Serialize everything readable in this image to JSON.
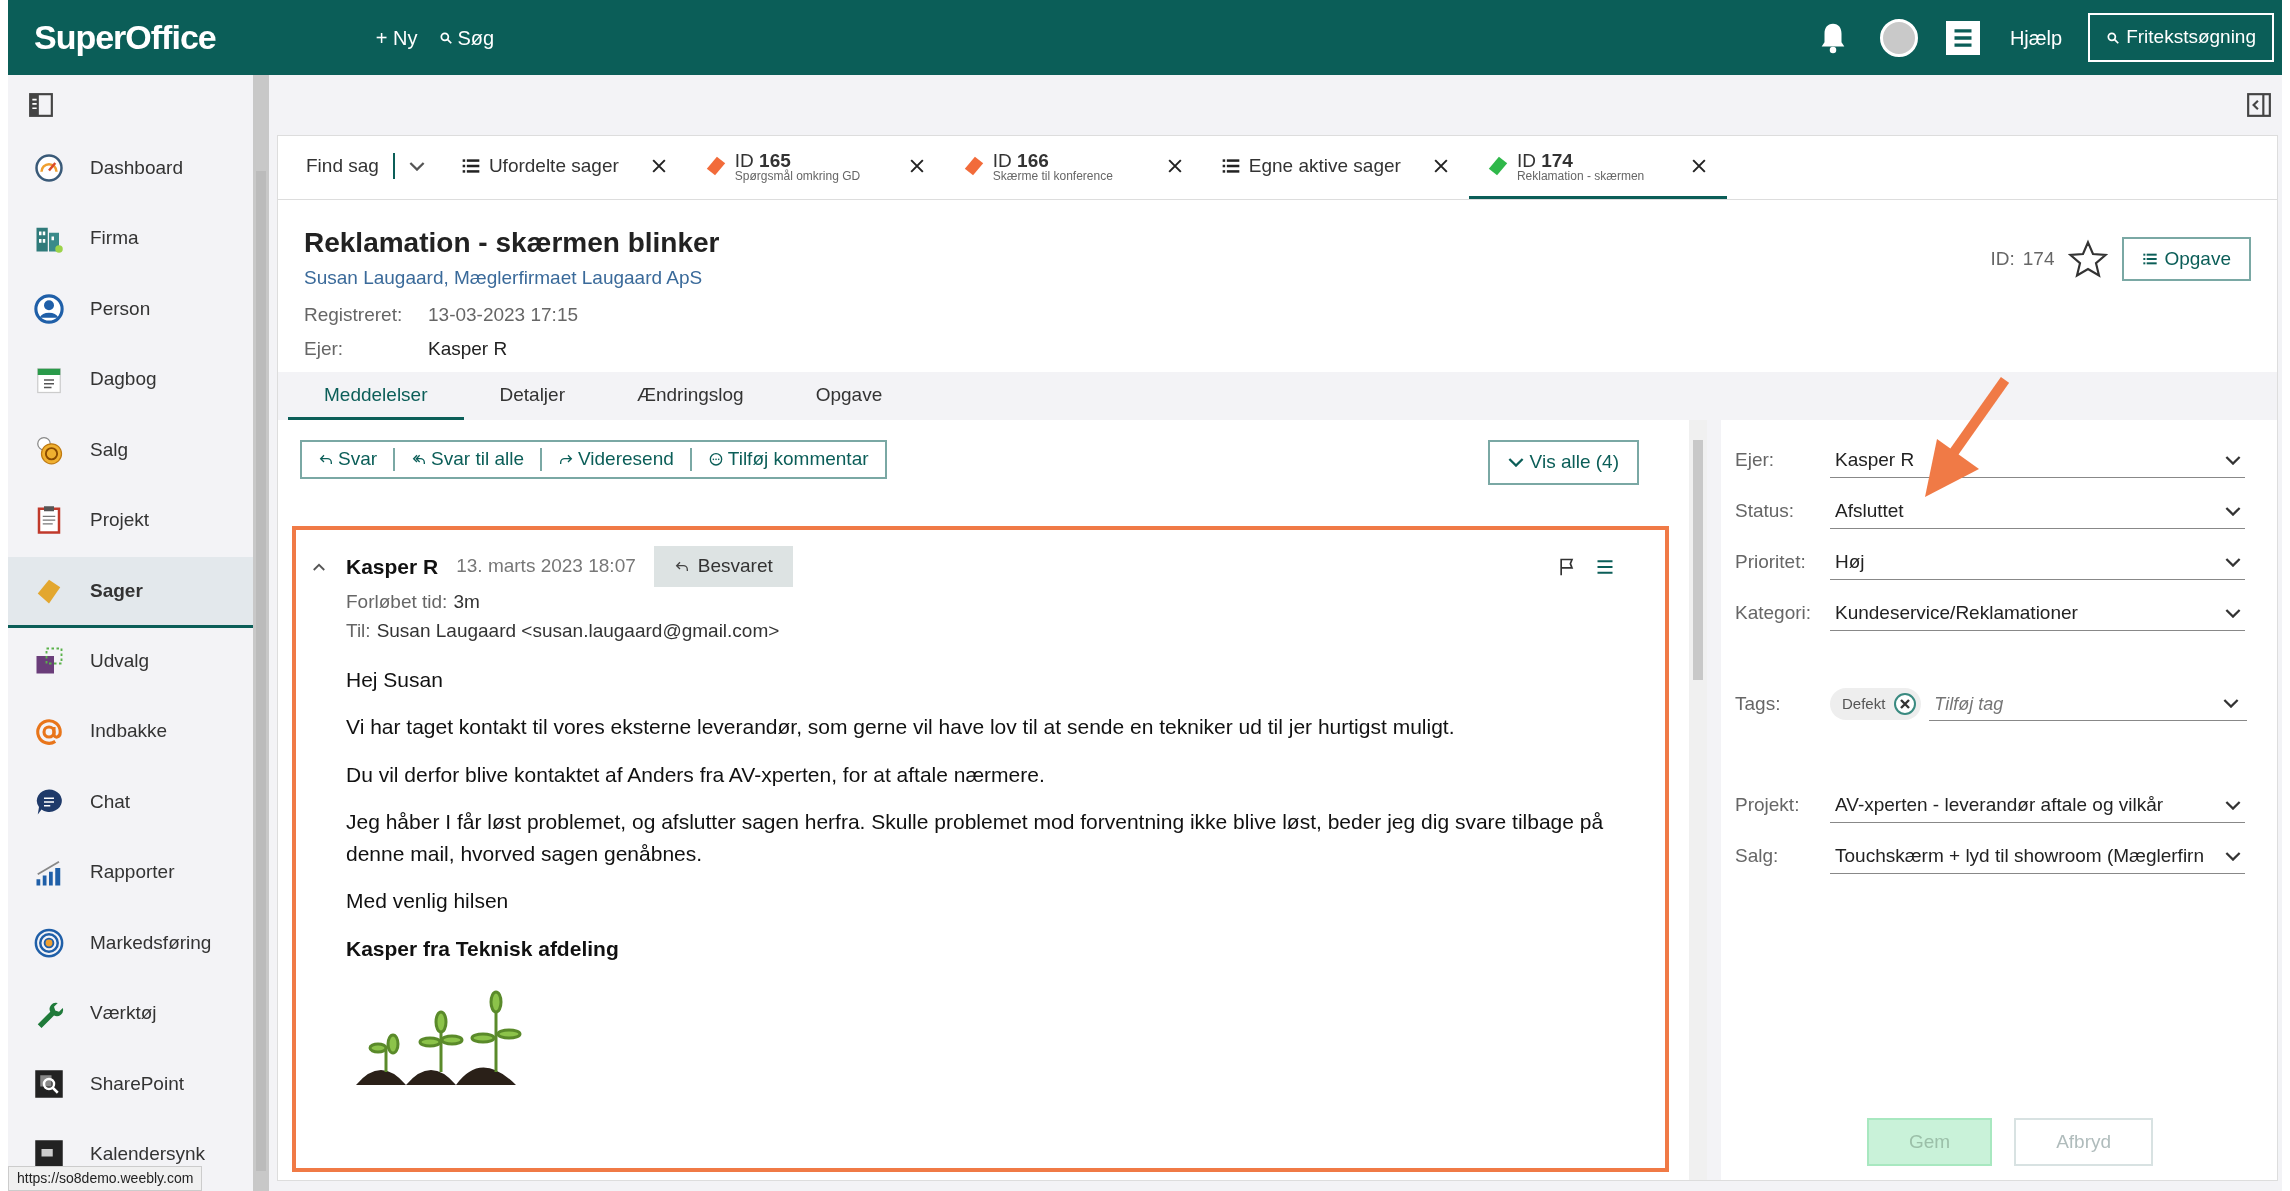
{
  "topbar": {
    "logo": "SuperOffice",
    "new": "+ Ny",
    "search": "Søg",
    "help": "Hjælp",
    "free_search": "Fritekstsøgning"
  },
  "sidebar": {
    "items": [
      {
        "label": "Dashboard",
        "selected": false
      },
      {
        "label": "Firma",
        "selected": false
      },
      {
        "label": "Person",
        "selected": false
      },
      {
        "label": "Dagbog",
        "selected": false
      },
      {
        "label": "Salg",
        "selected": false
      },
      {
        "label": "Projekt",
        "selected": false
      },
      {
        "label": "Sager",
        "selected": true
      },
      {
        "label": "Udvalg",
        "selected": false
      },
      {
        "label": "Indbakke",
        "selected": false
      },
      {
        "label": "Chat",
        "selected": false
      },
      {
        "label": "Rapporter",
        "selected": false
      },
      {
        "label": "Markedsføring",
        "selected": false
      },
      {
        "label": "Værktøj",
        "selected": false
      },
      {
        "label": "SharePoint",
        "selected": false
      },
      {
        "label": "Kalendersynk",
        "selected": false
      }
    ]
  },
  "tabs": [
    {
      "kind": "find",
      "label": "Find sag",
      "selected": false
    },
    {
      "kind": "list",
      "label": "Ufordelte sager",
      "selected": false
    },
    {
      "kind": "case",
      "label": "ID **165**",
      "subtitle": "Spørgsmål omkring GD",
      "color": "#f26b3a",
      "selected": false
    },
    {
      "kind": "case",
      "label": "ID **166**",
      "subtitle": "Skærme til konference",
      "color": "#f26b3a",
      "selected": false
    },
    {
      "kind": "list",
      "label": "Egne aktive sager",
      "selected": false
    },
    {
      "kind": "case",
      "label": "ID **174**",
      "subtitle": "Reklamation - skærmen",
      "color": "#2fb84a",
      "selected": true
    }
  ],
  "header": {
    "title": "Reklamation - skærmen blinker",
    "contact": "Susan Laugaard, Mæglerfirmaet Laugaard ApS",
    "fields": [
      {
        "label": "Registreret:",
        "value": "13-03-2023 17:15"
      },
      {
        "label": "Ejer:",
        "value": "Kasper R"
      }
    ],
    "id_label": "ID:",
    "id_value": "174",
    "favorite": false,
    "task_button": "Opgave"
  },
  "subtabs": [
    {
      "label": "Meddelelser",
      "selected": true
    },
    {
      "label": "Detaljer",
      "selected": false
    },
    {
      "label": "Ændringslog",
      "selected": false
    },
    {
      "label": "Opgave",
      "selected": false
    }
  ],
  "actions": [
    {
      "kind": "reply",
      "label": "Svar"
    },
    {
      "kind": "reply_all",
      "label": "Svar til alle"
    },
    {
      "kind": "forward",
      "label": "Videresend"
    },
    {
      "kind": "comment",
      "label": "Tilføj kommentar"
    }
  ],
  "show_all": "Vis alle (4)",
  "message": {
    "sender": "Kasper R",
    "date": "13. marts 2023 18:07",
    "status": "Besvaret",
    "expanded": true,
    "meta": [
      {
        "label": "Forløbet tid:",
        "value": "3m"
      },
      {
        "label": "Til:",
        "value": "Susan Laugaard <susan.laugaard@gmail.com>"
      }
    ],
    "body": [
      {
        "kind": "text",
        "text": "Hej Susan"
      },
      {
        "kind": "text",
        "text": "Vi har taget kontakt til vores eksterne leverandør, som gerne vil have lov til at sende en tekniker ud til jer hurtigst muligt."
      },
      {
        "kind": "text",
        "text": "Du vil derfor blive kontaktet af Anders fra AV-xperten, for at aftale nærmere."
      },
      {
        "kind": "text",
        "text": "Jeg håber I får løst problemet, og afslutter sagen herfra. Skulle problemet mod forventning ikke blive løst, beder jeg dig svare tilbage på denne mail, hvorved sagen genåbnes."
      },
      {
        "kind": "text",
        "text": "Med venlig hilsen"
      },
      {
        "kind": "signature",
        "text": "Kasper fra Teknisk afdeling"
      },
      {
        "kind": "image"
      }
    ]
  },
  "details": [
    {
      "kind": "select",
      "label": "Ejer:",
      "value": "Kasper R"
    },
    {
      "kind": "select",
      "label": "Status:",
      "value": "Afsluttet"
    },
    {
      "kind": "select",
      "label": "Prioritet:",
      "value": "Høj"
    },
    {
      "kind": "select",
      "label": "Kategori:",
      "value": "Kundeservice/Reklamationer"
    },
    {
      "kind": "tags",
      "label": "Tags:",
      "tags": [
        "Defekt"
      ],
      "placeholder": "Tilføj tag"
    },
    {
      "kind": "select",
      "label": "Projekt:",
      "value": "AV-xperten - leverandør aftale og vilkår"
    },
    {
      "kind": "select",
      "label": "Salg:",
      "value": "Touchskærm + lyd til showroom (Mæglerfirn"
    }
  ],
  "buttons": [
    {
      "kind": "primary",
      "label": "Gem",
      "disabled": true
    },
    {
      "kind": "secondary",
      "label": "Afbryd",
      "disabled": true
    }
  ],
  "status_url": "https://so8demo.weebly.com"
}
